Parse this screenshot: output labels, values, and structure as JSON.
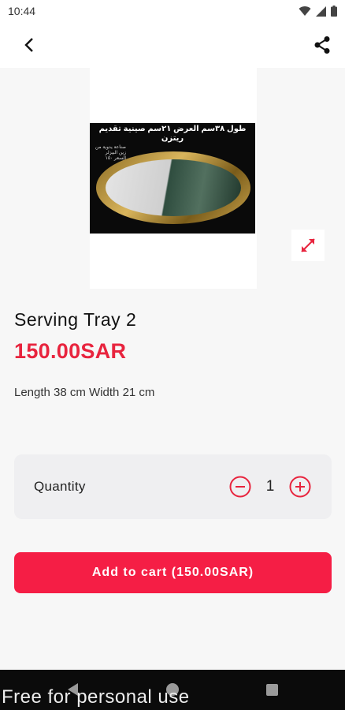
{
  "status_bar": {
    "time": "10:44"
  },
  "app_bar": {
    "back_icon": "back-arrow-icon",
    "share_icon": "share-icon"
  },
  "product": {
    "image_caption": "طول ٣٨سم العرض ٢١سم صينية تقديم ريتزن",
    "image_subcaption": "صناعة يدوية من زين البيزلر السعر ١٥٠",
    "title": "Serving Tray 2",
    "price": "150.00SAR",
    "description": "Length 38 cm Width 21 cm"
  },
  "quantity": {
    "label": "Quantity",
    "value": "1"
  },
  "cart": {
    "button_label": "Add to cart (150.00SAR)"
  },
  "watermark": "Free for personal use",
  "colors": {
    "accent": "#e8243e",
    "button": "#f51e45",
    "card": "#efeff1"
  }
}
